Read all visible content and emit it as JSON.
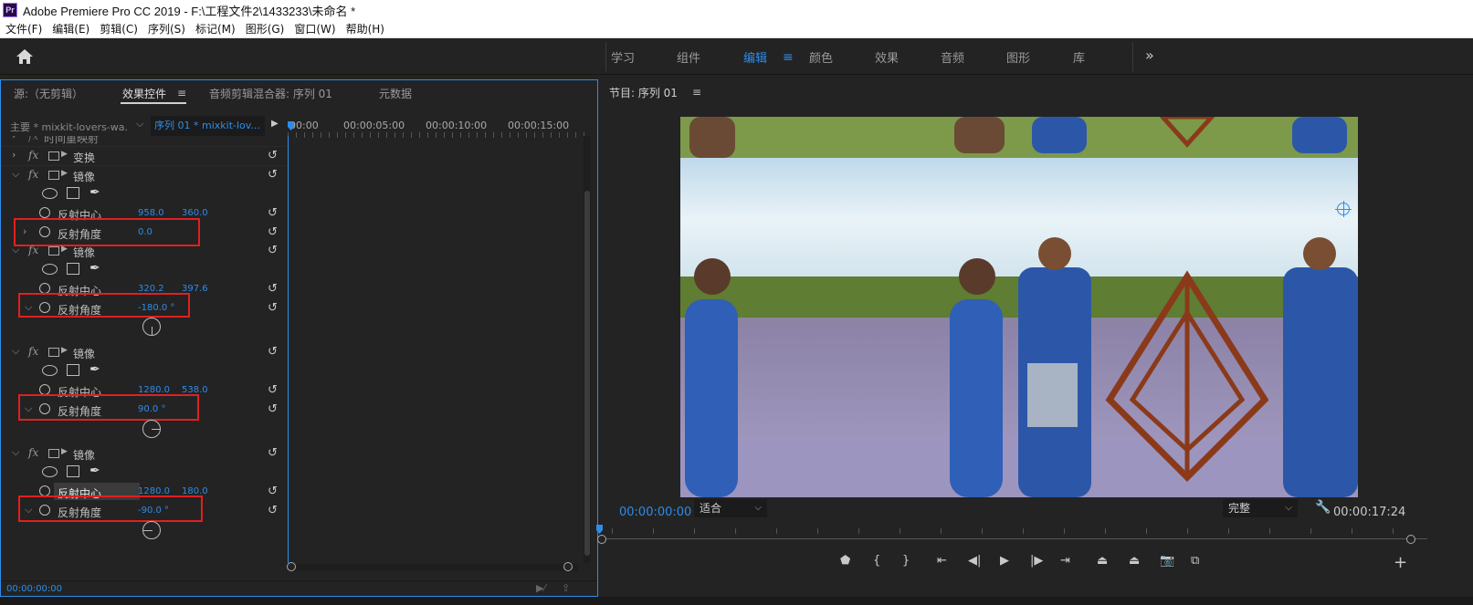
{
  "titlebar": {
    "logo": "Pr",
    "title": "Adobe Premiere Pro CC 2019 - F:\\工程文件2\\1433233\\未命名 *"
  },
  "menubar": [
    "文件(F)",
    "编辑(E)",
    "剪辑(C)",
    "序列(S)",
    "标记(M)",
    "图形(G)",
    "窗口(W)",
    "帮助(H)"
  ],
  "header": {
    "workspaces": [
      "学习",
      "组件",
      "编辑",
      "颜色",
      "效果",
      "音频",
      "图形",
      "库"
    ],
    "active_workspace": "编辑",
    "menu_glyph": "≡",
    "more_glyph": "»"
  },
  "left_panel": {
    "tabs": [
      "源:（无剪辑）",
      "效果控件",
      "音频剪辑混合器: 序列 01",
      "元数据"
    ],
    "active_tab": "效果控件",
    "tab_menu_glyph": "≡",
    "clip_master": "主要 * mixkit-lovers-wa...",
    "clip_sequence": "序列 01 * mixkit-lov...",
    "timeline_labels": [
      "00:00",
      "00:00:05:00",
      "00:00:10:00",
      "00:00:15:00"
    ],
    "time_readout": "00:00:00:00",
    "partial_top_label": "时间重映射",
    "transform_label": "变换",
    "mirror_effects": [
      {
        "name": "镜像",
        "center_label": "反射中心",
        "center_x": "958.0",
        "center_y": "360.0",
        "angle_label": "反射角度",
        "angle": "0.0"
      },
      {
        "name": "镜像",
        "center_label": "反射中心",
        "center_x": "320.2",
        "center_y": "397.6",
        "angle_label": "反射角度",
        "angle": "-180.0 °"
      },
      {
        "name": "镜像",
        "center_label": "反射中心",
        "center_x": "1280.0",
        "center_y": "538.0",
        "angle_label": "反射角度",
        "angle": "90.0 °"
      },
      {
        "name": "镜像",
        "center_label": "反射中心",
        "center_x": "1280.0",
        "center_y": "180.0",
        "angle_label": "反射角度",
        "angle": "-90.0 °"
      }
    ]
  },
  "program_monitor": {
    "title": "节目: 序列 01",
    "menu_glyph": "≡",
    "current_time": "00:00:00:00",
    "zoom": "适合",
    "quality": "完整",
    "duration": "00:00:17:24"
  },
  "icons": {
    "home": "home-icon",
    "reset": "reset-icon",
    "wrench": "wrench-icon",
    "add": "+"
  },
  "colors": {
    "accent": "#2d8ceb",
    "highlight_box": "#e02020",
    "panel_bg": "#232323"
  }
}
